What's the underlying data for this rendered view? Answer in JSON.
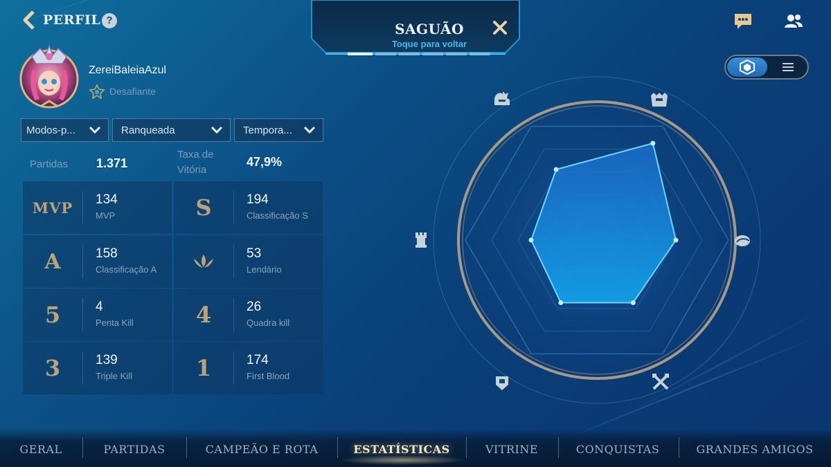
{
  "header": {
    "back_label": "PERFIL",
    "help_label": "?"
  },
  "profile": {
    "username": "ZereiBaleiaAzul",
    "rank": "Desafiante"
  },
  "filters": {
    "mode": "Modos-p...",
    "queue": "Ranqueada",
    "season": "Tempora..."
  },
  "summary": {
    "matches_label": "Partidas",
    "matches_value": "1.371",
    "winrate_label_line1": "Taxa de",
    "winrate_label_line2": "Vitória",
    "winrate_value": "47,9%"
  },
  "stats": [
    {
      "glyph": "MVP",
      "value": "134",
      "label": "MVP"
    },
    {
      "glyph": "S",
      "value": "194",
      "label": "Classificação S"
    },
    {
      "glyph": "A",
      "value": "158",
      "label": "Classificação A"
    },
    {
      "glyph": "legendary-icon",
      "value": "53",
      "label": "Lendário"
    },
    {
      "glyph": "5",
      "value": "4",
      "label": "Penta Kill"
    },
    {
      "glyph": "4",
      "value": "26",
      "label": "Quadra kill"
    },
    {
      "glyph": "3",
      "value": "139",
      "label": "Triple Kill"
    },
    {
      "glyph": "1",
      "value": "174",
      "label": "First Blood"
    }
  ],
  "lobby": {
    "title": "SAGUÃO",
    "subtitle": "Toque para voltar"
  },
  "top_right": {
    "icons": [
      "chat-icon",
      "friends-icon"
    ]
  },
  "view_toggle": {
    "active": "radar-view",
    "options": [
      "radar-view-icon",
      "list-view-icon"
    ]
  },
  "radar": {
    "axes_icons": [
      "assassin-helmet-icon",
      "fighter-helmet-icon",
      "mage-orb-icon",
      "attack-swords-icon",
      "defense-shield-icon",
      "support-tower-icon"
    ],
    "values": [
      0.85,
      0.6,
      0.55,
      0.55,
      0.5,
      0.62
    ]
  },
  "tabs": [
    {
      "label": "GERAL",
      "active": false
    },
    {
      "label": "PARTIDAS",
      "active": false
    },
    {
      "label": "CAMPEÃO E ROTA",
      "active": false
    },
    {
      "label": "ESTATÍSTICAS",
      "active": true
    },
    {
      "label": "VITRINE",
      "active": false
    },
    {
      "label": "CONQUISTAS",
      "active": false
    },
    {
      "label": "GRANDES AMIGOS",
      "active": false
    }
  ],
  "colors": {
    "accent_blue": "#47b8ee",
    "gold": "#b9a47a",
    "tab_active": "#f6e7bf"
  }
}
